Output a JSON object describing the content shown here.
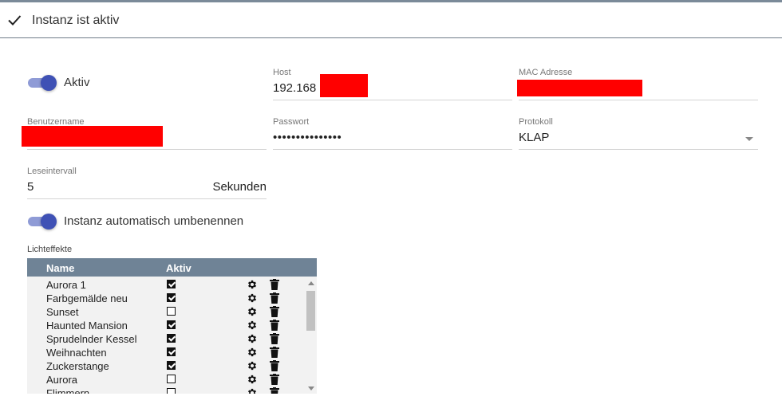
{
  "header": {
    "title": "Instanz ist aktiv",
    "icon": "check-icon"
  },
  "active_toggle": {
    "label": "Aktiv",
    "on": true
  },
  "host": {
    "label": "Host",
    "value": "192.168"
  },
  "mac": {
    "label": "MAC Adresse",
    "value": ""
  },
  "username": {
    "label": "Benutzername",
    "value": ""
  },
  "password": {
    "label": "Passwort",
    "value": "•••••••••••••••"
  },
  "protocol": {
    "label": "Protokoll",
    "value": "KLAP"
  },
  "interval": {
    "label": "Leseintervall",
    "value": "5",
    "unit": "Sekunden"
  },
  "rename_toggle": {
    "label": "Instanz automatisch umbenennen",
    "on": true
  },
  "effects": {
    "label": "Lichteffekte",
    "columns": [
      "Name",
      "Aktiv"
    ],
    "rows": [
      {
        "name": "Aurora 1",
        "active": true
      },
      {
        "name": "Farbgemälde neu",
        "active": true
      },
      {
        "name": "Sunset",
        "active": false
      },
      {
        "name": "Haunted Mansion",
        "active": true
      },
      {
        "name": "Sprudelnder Kessel",
        "active": true
      },
      {
        "name": "Weihnachten",
        "active": true
      },
      {
        "name": "Zuckerstange",
        "active": true
      },
      {
        "name": "Aurora",
        "active": false
      },
      {
        "name": "Flimmern",
        "active": false
      }
    ]
  },
  "colors": {
    "accent": "#3f51b5",
    "table_header": "#6f8396",
    "redaction": "#ff0000"
  }
}
